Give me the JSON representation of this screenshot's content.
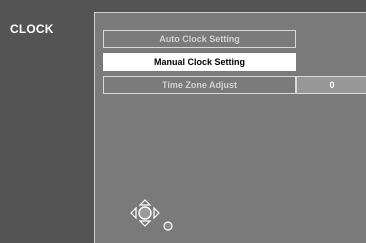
{
  "sidebar": {
    "title": "CLOCK"
  },
  "menu": {
    "items": [
      {
        "label": "Auto Clock Setting",
        "selected": false
      },
      {
        "label": "Manual Clock Setting",
        "selected": true
      },
      {
        "label": "Time Zone Adjust",
        "selected": false
      }
    ],
    "time_zone_value": "0"
  },
  "navigation": {
    "icons": [
      "up-arrow-icon",
      "down-arrow-icon",
      "left-arrow-icon",
      "right-arrow-icon",
      "ok-button-icon",
      "return-icon"
    ]
  },
  "colors": {
    "background": "#545454",
    "panel": "#7a7a7a",
    "selected": "#ffffff",
    "value_box": "#979797"
  }
}
